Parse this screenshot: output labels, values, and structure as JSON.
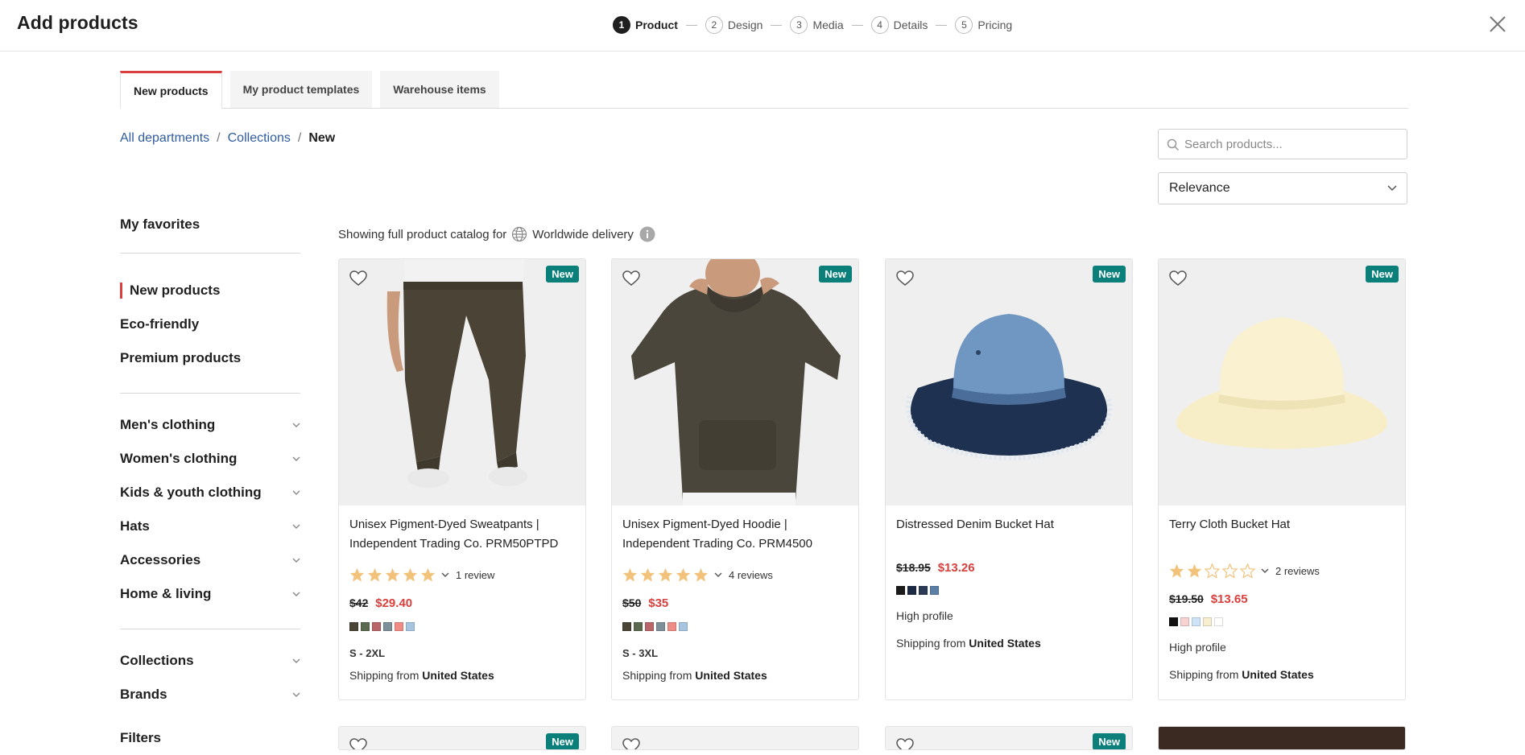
{
  "header": {
    "title": "Add products",
    "close_icon": "close-icon",
    "steps": [
      {
        "num": "1",
        "label": "Product"
      },
      {
        "num": "2",
        "label": "Design"
      },
      {
        "num": "3",
        "label": "Media"
      },
      {
        "num": "4",
        "label": "Details"
      },
      {
        "num": "5",
        "label": "Pricing"
      }
    ],
    "active_step": 1
  },
  "tabs": [
    {
      "label": "New products"
    },
    {
      "label": "My product templates"
    },
    {
      "label": "Warehouse items"
    }
  ],
  "breadcrumb": {
    "items": [
      "All departments",
      "Collections"
    ],
    "current": "New",
    "separator": "/"
  },
  "search": {
    "placeholder": "Search products..."
  },
  "sort": {
    "selected": "Relevance"
  },
  "sidebar": {
    "favorites": "My favorites",
    "collections": [
      "New products",
      "Eco-friendly",
      "Premium products"
    ],
    "categories": [
      "Men's clothing",
      "Women's clothing",
      "Kids & youth clothing",
      "Hats",
      "Accessories",
      "Home & living"
    ],
    "more": [
      "Collections",
      "Brands"
    ],
    "filters_partial": "Filters"
  },
  "catalog": {
    "prefix": "Showing full product catalog for",
    "delivery": "Worldwide delivery"
  },
  "colors": {
    "accent": "#d9403d",
    "badge": "#0b7f7a",
    "link": "#2e5c9e",
    "star": "#f2c27a"
  },
  "products": [
    {
      "name": "Unisex Pigment-Dyed Sweatpants | Independent Trading Co. PRM50PTPD",
      "badge": "New",
      "rating": 5,
      "reviews": "1 review",
      "old_price": "$42",
      "price": "$29.40",
      "swatches": [
        "#4a4436",
        "#5b6a4f",
        "#b8666a",
        "#7d8f98",
        "#f08c86",
        "#a7c4e0"
      ],
      "sizes": "S - 2XL",
      "ship_prefix": "Shipping from",
      "ship_country": "United States"
    },
    {
      "name": "Unisex Pigment-Dyed Hoodie | Independent Trading Co. PRM4500",
      "badge": "New",
      "rating": 5,
      "reviews": "4 reviews",
      "old_price": "$50",
      "price": "$35",
      "swatches": [
        "#4a4436",
        "#5b6a4f",
        "#b8666a",
        "#7d8f98",
        "#f08c86",
        "#a7c4e0"
      ],
      "sizes": "S - 3XL",
      "ship_prefix": "Shipping from",
      "ship_country": "United States"
    },
    {
      "name": "Distressed Denim Bucket Hat",
      "badge": "New",
      "old_price": "$18.95",
      "price": "$13.26",
      "swatches": [
        "#1b1b1b",
        "#1d2a44",
        "#2b3a55",
        "#5b7fa6"
      ],
      "profile": "High profile",
      "ship_prefix": "Shipping from",
      "ship_country": "United States"
    },
    {
      "name": "Terry Cloth Bucket Hat",
      "badge": "New",
      "rating": 2,
      "reviews": "2 reviews",
      "old_price": "$19.50",
      "price": "$13.65",
      "swatches": [
        "#111111",
        "#f6d2d2",
        "#cfe3f6",
        "#f7efd0",
        "#ffffff"
      ],
      "profile": "High profile",
      "ship_prefix": "Shipping from",
      "ship_country": "United States"
    }
  ],
  "peek_badge": "New"
}
